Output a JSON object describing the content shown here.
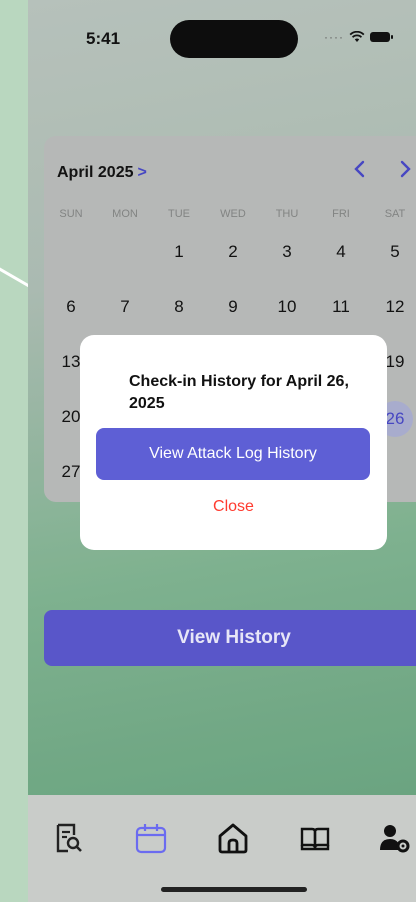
{
  "status_bar": {
    "time": "5:41"
  },
  "calendar": {
    "month_label": "April 2025",
    "month_chevron": ">",
    "prev_icon": "<",
    "next_icon": ">",
    "weekdays": [
      "SUN",
      "MON",
      "TUE",
      "WED",
      "THU",
      "FRI",
      "SAT"
    ],
    "weeks": [
      [
        "",
        "",
        "1",
        "2",
        "3",
        "4",
        "5"
      ],
      [
        "6",
        "7",
        "8",
        "9",
        "10",
        "11",
        "12"
      ],
      [
        "13",
        "",
        "",
        "",
        "",
        "",
        "19"
      ],
      [
        "20",
        "",
        "",
        "",
        "",
        "",
        "26"
      ],
      [
        "27",
        "",
        "",
        "",
        "",
        "",
        ""
      ]
    ],
    "selected_day": "26",
    "accent_color": "#4a4ad0"
  },
  "modal": {
    "title": "Check-in History for April 26, 2025",
    "primary_button": "View Attack Log History",
    "close_button": "Close"
  },
  "main": {
    "view_history_button": "View History"
  },
  "tabbar": {
    "tabs": [
      {
        "icon": "search-document-icon",
        "active": false
      },
      {
        "icon": "calendar-icon",
        "active": true
      },
      {
        "icon": "home-icon",
        "active": false
      },
      {
        "icon": "book-icon",
        "active": false
      },
      {
        "icon": "user-settings-icon",
        "active": false
      }
    ]
  }
}
